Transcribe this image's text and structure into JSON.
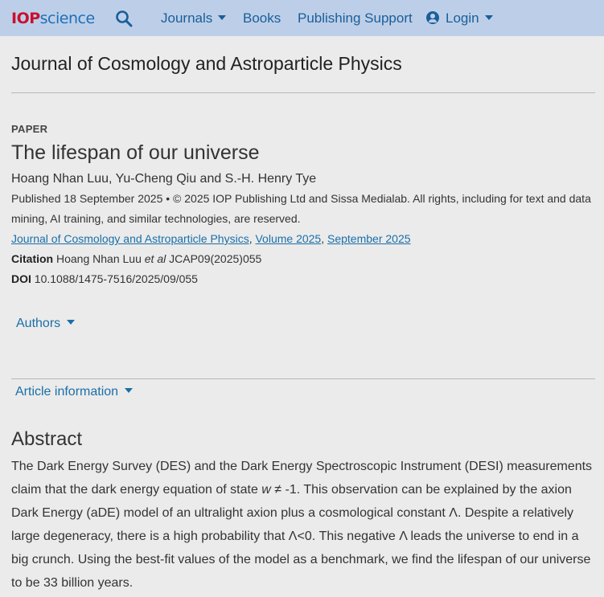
{
  "header": {
    "logo_prefix": "IOP",
    "logo_suffix": "science",
    "search_icon": "search-icon",
    "nav": {
      "journals": "Journals",
      "books": "Books",
      "publishing_support": "Publishing Support",
      "login": "Login"
    }
  },
  "journal_title": "Journal of Cosmology and Astroparticle Physics",
  "article": {
    "type": "PAPER",
    "title": "The lifespan of our universe",
    "authors": "Hoang Nhan Luu, Yu-Cheng Qiu and S.-H. Henry Tye",
    "published": "Published 18 September 2025 • © 2025 IOP Publishing Ltd and Sissa Medialab. All rights, including for text and data mining, AI training, and similar technologies, are reserved.",
    "breadcrumb": {
      "journal": "Journal of Cosmology and Astroparticle Physics",
      "volume": "Volume 2025",
      "issue": "September 2025",
      "sep": ", "
    },
    "citation_label": "Citation",
    "citation_authors": "Hoang Nhan Luu",
    "citation_etal": "et al",
    "citation_ref": "JCAP09(2025)055",
    "doi_label": "DOI",
    "doi_value": "10.1088/1475-7516/2025/09/055"
  },
  "sections": {
    "authors_toggle": "Authors",
    "article_info_toggle": "Article information"
  },
  "abstract": {
    "heading": "Abstract",
    "part1": "The Dark Energy Survey (DES) and the Dark Energy Spectroscopic Instrument (DESI) measurements claim that the dark energy equation of state ",
    "var_w": "w",
    "part2": " ≠ -1. This observation can be explained by the axion Dark Energy (aDE) model of an ultralight axion plus a cosmological constant Λ. Despite a relatively large degeneracy, there is a high probability that Λ<0. This negative Λ leads the universe to end in a big crunch. Using the best-fit values of the model as a benchmark, we find the lifespan of our universe to be 33 billion years."
  },
  "colors": {
    "topbar": "#bdcfe8",
    "logo_red": "#c8102e",
    "logo_blue": "#1e6fb8",
    "link": "#1a6fa8"
  }
}
